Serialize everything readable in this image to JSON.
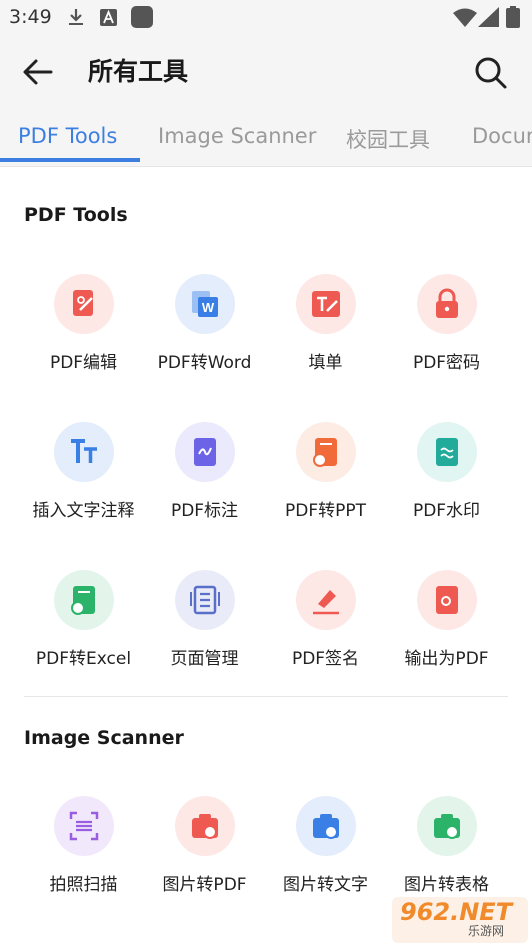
{
  "status_bar": {
    "time": "3:49"
  },
  "header": {
    "title": "所有工具"
  },
  "tabs": [
    {
      "label": "PDF Tools"
    },
    {
      "label": "Image Scanner"
    },
    {
      "label": "校园工具"
    },
    {
      "label": "Docum"
    }
  ],
  "sections": [
    {
      "title": "PDF Tools",
      "tools": [
        {
          "label": "PDF编辑",
          "icon": "pdf-edit-icon",
          "bg": "#fde8e6",
          "fg": "#ee5a52"
        },
        {
          "label": "PDF转Word",
          "icon": "pdf-to-word-icon",
          "bg": "#e3edfb",
          "fg": "#3a7fe5"
        },
        {
          "label": "填单",
          "icon": "fill-form-icon",
          "bg": "#fde8e6",
          "fg": "#ee5a52"
        },
        {
          "label": "PDF密码",
          "icon": "lock-icon",
          "bg": "#fde8e6",
          "fg": "#ee5a52"
        },
        {
          "label": "插入文字注释",
          "icon": "text-annotation-icon",
          "bg": "#e3edfb",
          "fg": "#3a7fe5"
        },
        {
          "label": "PDF标注",
          "icon": "annotate-icon",
          "bg": "#ebeafc",
          "fg": "#6c63e6"
        },
        {
          "label": "PDF转PPT",
          "icon": "pdf-to-ppt-icon",
          "bg": "#fdece4",
          "fg": "#f06a3a"
        },
        {
          "label": "PDF水印",
          "icon": "watermark-icon",
          "bg": "#e1f5f3",
          "fg": "#22aa9a"
        },
        {
          "label": "PDF转Excel",
          "icon": "pdf-to-excel-icon",
          "bg": "#e3f5ea",
          "fg": "#2bb36a"
        },
        {
          "label": "页面管理",
          "icon": "page-manage-icon",
          "bg": "#e9ecf8",
          "fg": "#5a6fc8"
        },
        {
          "label": "PDF签名",
          "icon": "signature-icon",
          "bg": "#fde8e6",
          "fg": "#ee5a52"
        },
        {
          "label": "输出为PDF",
          "icon": "export-pdf-icon",
          "bg": "#fde8e6",
          "fg": "#ee5a52"
        }
      ]
    },
    {
      "title": "Image Scanner",
      "tools": [
        {
          "label": "拍照扫描",
          "icon": "scan-icon",
          "bg": "#f1e9fb",
          "fg": "#9a5ce0"
        },
        {
          "label": "图片转PDF",
          "icon": "image-to-pdf-icon",
          "bg": "#fde8e6",
          "fg": "#ee5a52"
        },
        {
          "label": "图片转文字",
          "icon": "image-to-text-icon",
          "bg": "#e3edfb",
          "fg": "#3a7fe5"
        },
        {
          "label": "图片转表格",
          "icon": "image-to-table-icon",
          "bg": "#e3f5ea",
          "fg": "#2bb36a"
        }
      ]
    }
  ],
  "watermark": {
    "text": "962.NET",
    "sub": "乐游网"
  }
}
